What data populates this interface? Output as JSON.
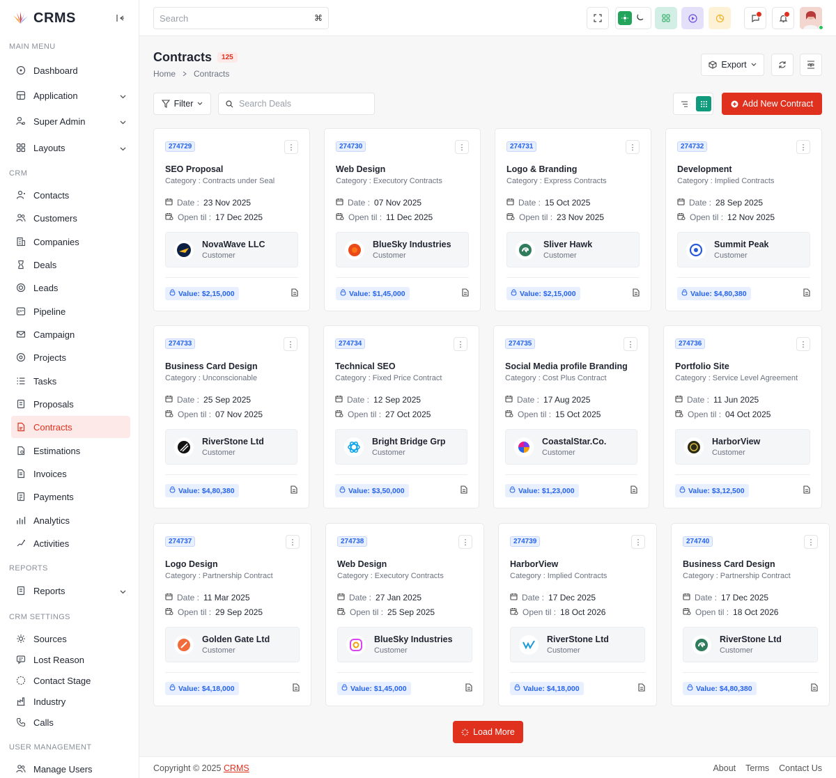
{
  "brand": {
    "name": "CRMS"
  },
  "sidebar": {
    "sections": [
      {
        "title": "MAIN MENU",
        "items": [
          {
            "label": "Dashboard",
            "icon": "dashboard-icon",
            "chevron": false
          },
          {
            "label": "Application",
            "icon": "apps-icon",
            "chevron": true
          },
          {
            "label": "Super Admin",
            "icon": "user-cog-icon",
            "chevron": true
          },
          {
            "label": "Layouts",
            "icon": "layout-icon",
            "chevron": true
          }
        ]
      },
      {
        "title": "CRM",
        "items": [
          {
            "label": "Contacts",
            "icon": "contact-icon"
          },
          {
            "label": "Customers",
            "icon": "users-icon"
          },
          {
            "label": "Companies",
            "icon": "building-icon"
          },
          {
            "label": "Deals",
            "icon": "deal-icon"
          },
          {
            "label": "Leads",
            "icon": "target-icon"
          },
          {
            "label": "Pipeline",
            "icon": "pipeline-icon"
          },
          {
            "label": "Campaign",
            "icon": "mail-icon"
          },
          {
            "label": "Projects",
            "icon": "project-icon"
          },
          {
            "label": "Tasks",
            "icon": "tasks-icon"
          },
          {
            "label": "Proposals",
            "icon": "proposal-icon"
          },
          {
            "label": "Contracts",
            "icon": "contract-icon",
            "active": true
          },
          {
            "label": "Estimations",
            "icon": "estimate-icon"
          },
          {
            "label": "Invoices",
            "icon": "invoice-icon"
          },
          {
            "label": "Payments",
            "icon": "payment-icon"
          },
          {
            "label": "Analytics",
            "icon": "analytics-icon"
          },
          {
            "label": "Activities",
            "icon": "activity-icon"
          }
        ]
      },
      {
        "title": "REPORTS",
        "items": [
          {
            "label": "Reports",
            "icon": "report-icon",
            "chevron": true
          }
        ]
      },
      {
        "title": "CRM SETTINGS",
        "items": [
          {
            "label": "Sources",
            "icon": "source-icon"
          },
          {
            "label": "Lost Reason",
            "icon": "message-icon"
          },
          {
            "label": "Contact Stage",
            "icon": "stage-icon"
          },
          {
            "label": "Industry",
            "icon": "industry-icon"
          },
          {
            "label": "Calls",
            "icon": "phone-icon"
          }
        ]
      },
      {
        "title": "USER MANAGEMENT",
        "items": [
          {
            "label": "Manage Users",
            "icon": "users-icon"
          }
        ]
      }
    ]
  },
  "header": {
    "search_placeholder": "Search",
    "shortcut": "⌘"
  },
  "page": {
    "title": "Contracts",
    "count": "125",
    "breadcrumb_home": "Home",
    "breadcrumb_current": "Contracts"
  },
  "toolbar": {
    "export_label": "Export",
    "filter_label": "Filter",
    "search_deals_placeholder": "Search Deals",
    "add_label": "Add New Contract",
    "load_more_label": "Load More"
  },
  "labels": {
    "date": "Date :",
    "open_til": "Open til :",
    "customer": "Customer"
  },
  "contracts": [
    {
      "id": "274729",
      "title": "SEO Proposal",
      "category": "Category : Contracts under Seal",
      "date": "23 Nov 2025",
      "open_til": "17 Dec 2025",
      "customer": "NovaWave LLC",
      "logo_color": "#1e3a8a",
      "value": "Value: $2,15,000"
    },
    {
      "id": "274730",
      "title": "Web Design",
      "category": "Category : Executory Contracts",
      "date": "07 Nov 2025",
      "open_til": "11 Dec 2025",
      "customer": "BlueSky Industries",
      "logo_color": "#ea4a1a",
      "value": "Value: $1,45,000"
    },
    {
      "id": "274731",
      "title": "Logo & Branding",
      "category": "Category : Express Contracts",
      "date": "15 Oct 2025",
      "open_til": "23 Nov 2025",
      "customer": "Sliver Hawk",
      "logo_color": "#2f7d5c",
      "value": "Value: $2,15,000"
    },
    {
      "id": "274732",
      "title": "Development",
      "category": "Category : Implied Contracts",
      "date": "28 Sep 2025",
      "open_til": "12 Nov 2025",
      "customer": "Summit Peak",
      "logo_color": "#2a5bd7",
      "value": "Value: $4,80,380"
    },
    {
      "id": "274733",
      "title": "Business Card Design",
      "category": "Category : Unconscionable",
      "date": "25 Sep 2025",
      "open_til": "07 Nov 2025",
      "customer": "RiverStone Ltd",
      "logo_color": "#111111",
      "value": "Value: $4,80,380"
    },
    {
      "id": "274734",
      "title": "Technical SEO",
      "category": "Category : Fixed Price Contract",
      "date": "12 Sep 2025",
      "open_til": "27 Oct 2025",
      "customer": "Bright Bridge Grp",
      "logo_color": "#0ea5e9",
      "value": "Value: $3,50,000"
    },
    {
      "id": "274735",
      "title": "Social Media profile Branding",
      "category": "Category : Cost Plus Contract",
      "date": "17 Aug 2025",
      "open_til": "15 Oct 2025",
      "customer": "CoastalStar.Co.",
      "logo_color": "#e11d8f",
      "value": "Value: $1,23,000"
    },
    {
      "id": "274736",
      "title": "Portfolio Site",
      "category": "Category : Service Level Agreement",
      "date": "11 Jun 2025",
      "open_til": "04 Oct 2025",
      "customer": "HarborView",
      "logo_color": "#3a3a1a",
      "value": "Value: $3,12,500"
    },
    {
      "id": "274737",
      "title": "Logo Design",
      "category": "Category : Partnership  Contract",
      "date": "11 Mar 2025",
      "open_til": "29 Sep 2025",
      "customer": "Golden Gate Ltd",
      "logo_color": "#f26b3a",
      "value": "Value: $4,18,000"
    },
    {
      "id": "274738",
      "title": "Web Design",
      "category": "Category : Executory Contracts",
      "date": "27 Jan 2025",
      "open_til": "25 Sep 2025",
      "customer": "BlueSky Industries",
      "logo_color": "#d946ef",
      "value": "Value: $1,45,000"
    },
    {
      "id": "274739",
      "title": "HarborView",
      "category": "Category : Implied Contracts",
      "date": "17 Dec 2025",
      "open_til": "18 Oct 2026",
      "customer": "RiverStone Ltd",
      "logo_color": "#1d9bd7",
      "value": "Value: $4,18,000"
    },
    {
      "id": "274740",
      "title": "Business Card Design",
      "category": "Category : Partnership  Contract",
      "date": "17 Dec 2025",
      "open_til": "18 Oct 2026",
      "customer": "RiverStone Ltd",
      "logo_color": "#2f7d5c",
      "value": "Value: $4,80,380"
    }
  ],
  "footer": {
    "copyright": "Copyright © 2025 ",
    "brand_link": "CRMS",
    "links": [
      "About",
      "Terms",
      "Contact Us"
    ]
  },
  "colors": {
    "accent": "#e0301e",
    "info": "#2563eb"
  }
}
